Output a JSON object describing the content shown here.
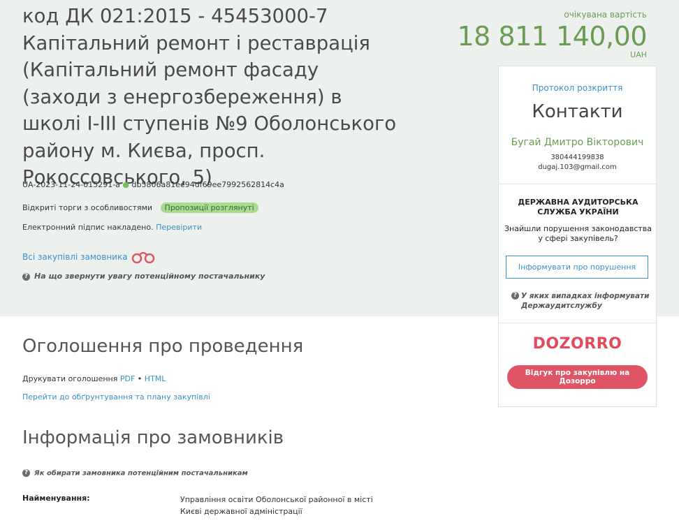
{
  "header": {
    "title": "код ДК 021:2015 - 45453000-7 Капітальний ремонт і реставрація (Капітальний ремонт фасаду (заходи з енергозбереження) в школі I-III ступенів №9 Оболонського району м. Києва, просп. Рокоссовського, 5)",
    "tender_id": "UA-2023-11-24-015291-a",
    "tender_hash": "db5806a81ee94df69ee7992562814c4a",
    "procedure": "Відкриті торги з особливостями",
    "status_badge": "Пропозиції розглянуті",
    "signature_text": "Електронний підпис накладено.",
    "verify_link": "Перевірити",
    "all_purchases_link": "Всі закупівлі замовника",
    "supplier_help": "На що звернути увагу потенційному постачальнику"
  },
  "expected_value": {
    "label": "очікувана вартість",
    "amount": "18 811 140,00",
    "currency": "UAH"
  },
  "contacts": {
    "protocol_link": "Протокол розкриття",
    "heading": "Контакти",
    "name": "Бугай Дмитро Вікторович",
    "phone": "380444199838",
    "email": "dugaj.103@gmail.com"
  },
  "audit": {
    "title": "ДЕРЖАВНА АУДИТОРСЬКА СЛУЖБА УКРАЇНИ",
    "text": "Знайшли порушення законодавства у сфері закупівель?",
    "button": "Інформувати про порушення",
    "help": "У яких випадках інформувати Держаудитслужбу"
  },
  "dozorro": {
    "logo": "DOZORRO",
    "button": "Відгук про закупівлю на Дозорро"
  },
  "announcement": {
    "heading": "Оголошення про проведення",
    "print_label": "Друкувати оголошення",
    "pdf": "PDF",
    "separator": "•",
    "html": "HTML",
    "plan_link": "Перейти до обґрунтування та плану закупівлі"
  },
  "customers": {
    "heading": "Інформація про замовників",
    "help": "Як обирати замовника потенційним постачальникам",
    "name_label": "Найменування:",
    "name_value": "Управління освіти Оболонської районної в місті Києві державної адміністрації"
  },
  "colors": {
    "band": "#edf1ee",
    "green": "#6a9c54",
    "link": "#3d8fc7",
    "dozorro": "#e05565"
  }
}
